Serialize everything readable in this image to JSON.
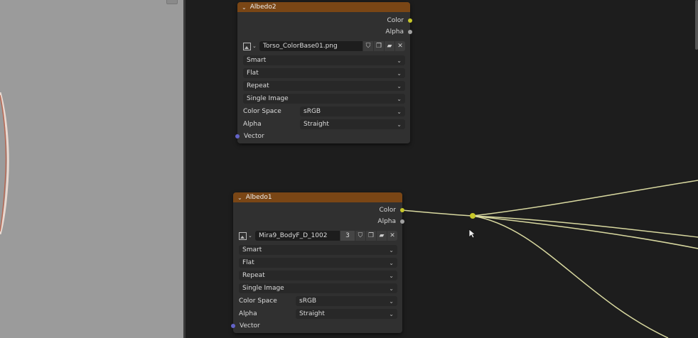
{
  "colors": {
    "viewport_bg": "#9b9b9b",
    "editor_bg": "#1d1d1d",
    "node_bg": "#303030",
    "node_header": "#7a4615",
    "socket_color": "#c7c729",
    "socket_alpha": "#a1a1a1",
    "socket_vector": "#6363c7",
    "wire": "#d9d9a0"
  },
  "nodes": [
    {
      "title": "Albedo2",
      "outputs": [
        "Color",
        "Alpha"
      ],
      "image_name": "Torso_ColorBase01.png",
      "user_count": "",
      "interpolation": "Smart",
      "projection": "Flat",
      "extension": "Repeat",
      "source": "Single Image",
      "color_space_label": "Color Space",
      "color_space": "sRGB",
      "alpha_label": "Alpha",
      "alpha_mode": "Straight",
      "input": "Vector"
    },
    {
      "title": "Albedo1",
      "outputs": [
        "Color",
        "Alpha"
      ],
      "image_name": "Mira9_BodyF_D_1002",
      "user_count": "3",
      "interpolation": "Smart",
      "projection": "Flat",
      "extension": "Repeat",
      "source": "Single Image",
      "color_space_label": "Color Space",
      "color_space": "sRGB",
      "alpha_label": "Alpha",
      "alpha_mode": "Straight",
      "input": "Vector"
    }
  ],
  "icons": [
    "image-type-icon",
    "shield-icon",
    "duplicate-icon",
    "folder-icon",
    "close-icon",
    "chevron-down-icon",
    "mouse-cursor-icon",
    "reroute-icon"
  ]
}
